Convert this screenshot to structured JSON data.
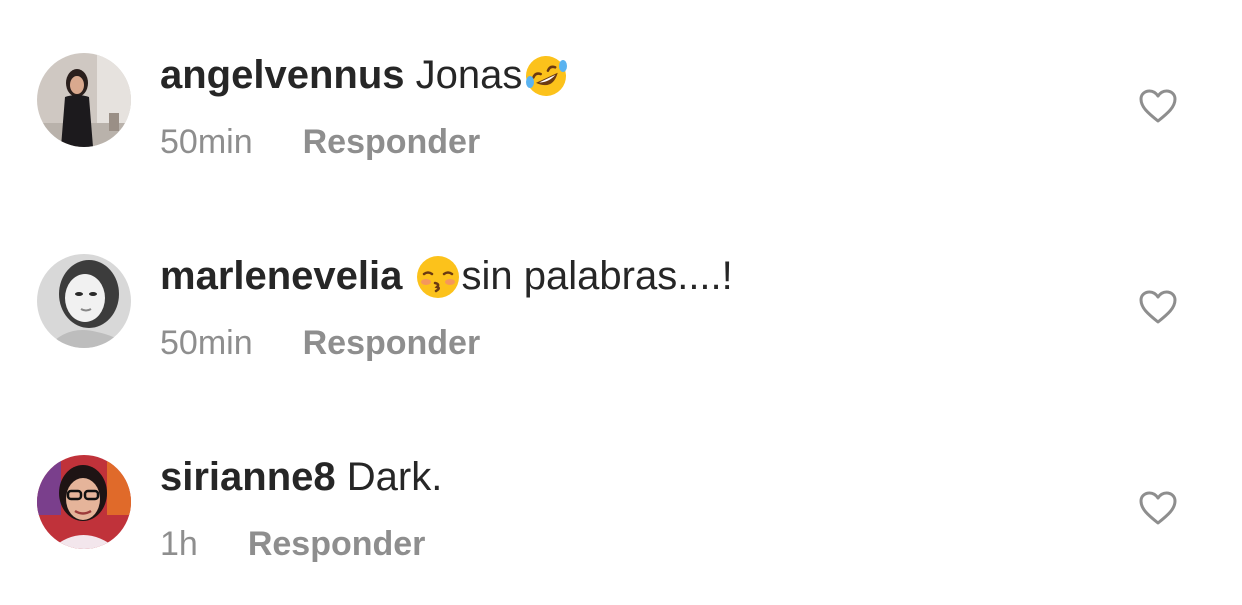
{
  "comments": [
    {
      "username": "angelvennus",
      "text_before": " Jonas",
      "emoji": "rofl-emoji",
      "text_after": "",
      "time": "50min",
      "reply_label": "Responder"
    },
    {
      "username": "marlenevelia",
      "text_before": " ",
      "emoji": "kissing-closed-eyes-emoji",
      "text_after": "sin palabras....!",
      "time": "50min",
      "reply_label": "Responder"
    },
    {
      "username": "sirianne8",
      "text_before": " Dark.",
      "emoji": "",
      "text_after": "",
      "time": "1h",
      "reply_label": "Responder"
    }
  ],
  "icons": {
    "like": "heart-outline-icon"
  },
  "colors": {
    "primary_text": "#262626",
    "secondary_text": "#8e8e8e",
    "background": "#ffffff"
  }
}
